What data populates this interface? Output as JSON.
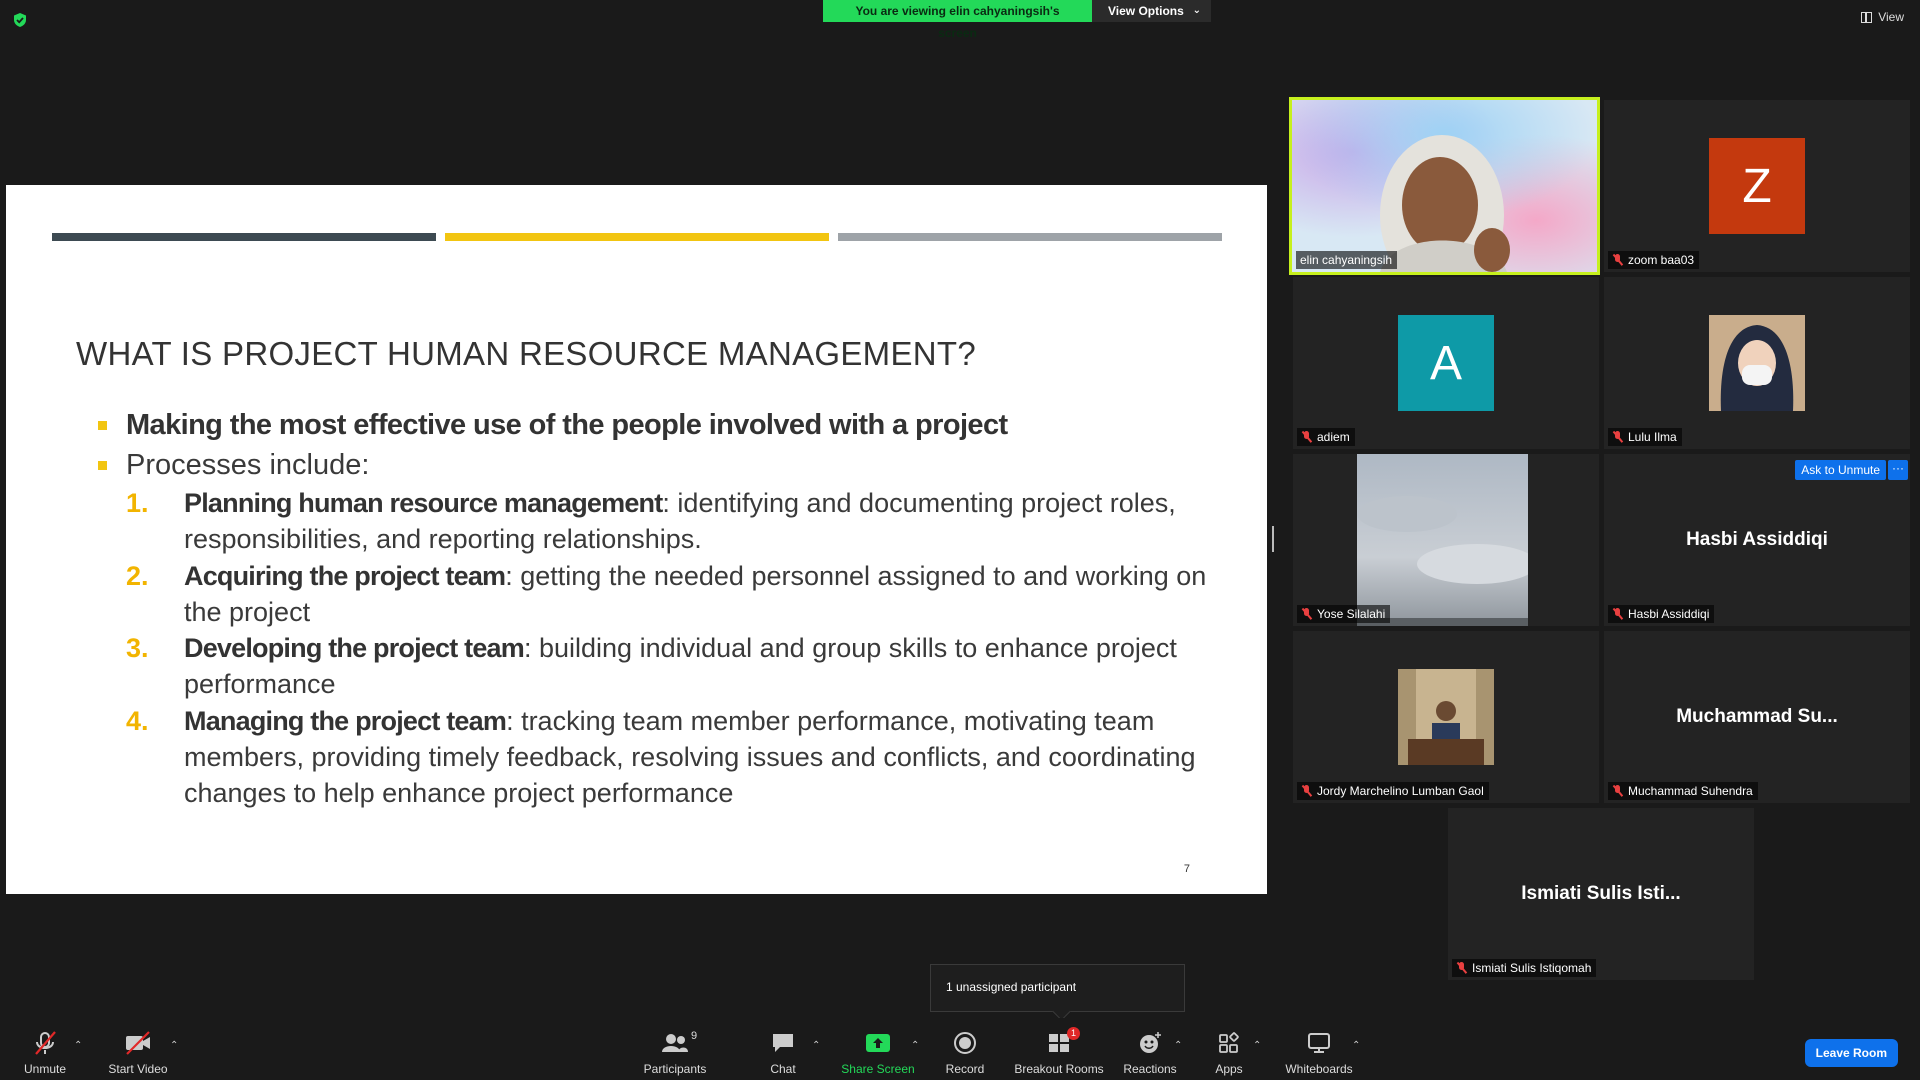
{
  "topbar": {
    "viewing_text": "You are viewing elin cahyaningsih's screen",
    "view_options_label": "View Options",
    "view_label": "View"
  },
  "slide": {
    "title": "WHAT IS PROJECT HUMAN RESOURCE MANAGEMENT?",
    "bullets": [
      "Making the most effective use of the people involved with a project",
      "Processes include:"
    ],
    "processes": [
      {
        "num": "1.",
        "term": "Planning human resource management",
        "desc": ": identifying and documenting project roles, responsibilities, and reporting relationships."
      },
      {
        "num": "2.",
        "term": "Acquiring the project team",
        "desc": ": getting the needed personnel assigned to and working on the project"
      },
      {
        "num": "3.",
        "term": "Developing the project team",
        "desc": ": building individual and group skills to enhance project performance"
      },
      {
        "num": "4.",
        "term": "Managing the project team",
        "desc": ": tracking team member performance, motivating team members, providing timely feedback, resolving issues and conflicts, and coordinating changes to help enhance project performance"
      }
    ],
    "page_number": "7",
    "colors": {
      "dark_bar": "#3d4a52",
      "accent": "#f2c511",
      "grey_bar": "#9ea3a8"
    }
  },
  "participants": [
    {
      "name": "elin cahyaningsih"
    },
    {
      "name": "zoom baa03",
      "initial": "Z",
      "color": "#c4390e"
    },
    {
      "name": "adiem",
      "initial": "A",
      "color": "#0e9aa7"
    },
    {
      "name": "Lulu Ilma"
    },
    {
      "name": "Yose Silalahi"
    },
    {
      "name": "Hasbi Assiddiqi",
      "display": "Hasbi Assiddiqi",
      "ask_unmute": "Ask to Unmute",
      "more": "···"
    },
    {
      "name": "Jordy Marchelino Lumban Gaol"
    },
    {
      "name": "Muchammad Suhendra",
      "display": "Muchammad  Su..."
    },
    {
      "name": "Ismiati Sulis Istiqomah",
      "display": "Ismiati  Sulis  Isti..."
    }
  ],
  "tooltip": {
    "text": "1 unassigned participant"
  },
  "toolbar": {
    "unmute": "Unmute",
    "start_video": "Start Video",
    "participants": "Participants",
    "participants_count": "9",
    "chat": "Chat",
    "share_screen": "Share Screen",
    "record": "Record",
    "breakout_rooms": "Breakout Rooms",
    "breakout_badge": "1",
    "reactions": "Reactions",
    "apps": "Apps",
    "whiteboards": "Whiteboards",
    "leave_room": "Leave Room"
  }
}
